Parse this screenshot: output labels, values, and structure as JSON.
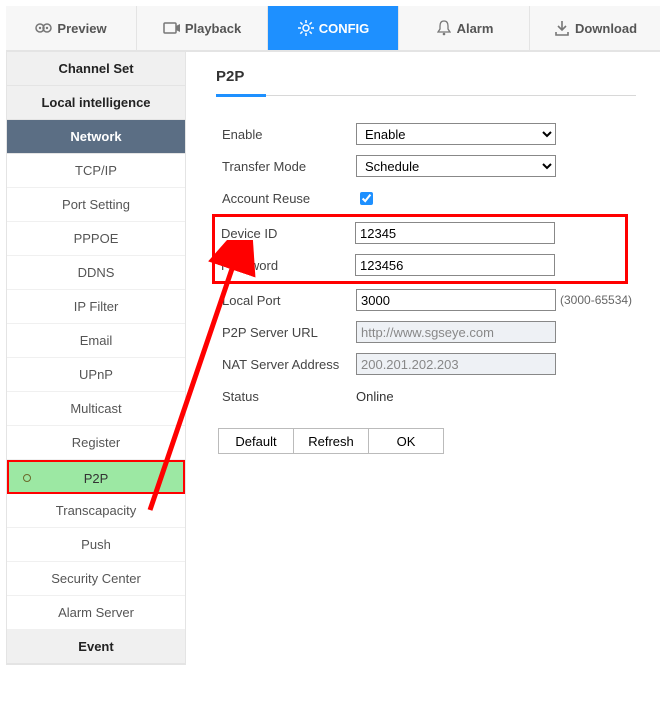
{
  "topnav": {
    "preview": "Preview",
    "playback": "Playback",
    "config": "CONFIG",
    "alarm": "Alarm",
    "download": "Download"
  },
  "sidebar": {
    "channel_set": "Channel Set",
    "local_intel": "Local intelligence",
    "network": "Network",
    "items": {
      "tcpip": "TCP/IP",
      "port": "Port Setting",
      "pppoe": "PPPOE",
      "ddns": "DDNS",
      "ipfilter": "IP Filter",
      "email": "Email",
      "upnp": "UPnP",
      "multicast": "Multicast",
      "register": "Register",
      "p2p": "P2P",
      "transcap": "Transcapacity",
      "push": "Push",
      "seccenter": "Security Center",
      "alarmsrv": "Alarm Server"
    },
    "event": "Event"
  },
  "page": {
    "title": "P2P",
    "labels": {
      "enable": "Enable",
      "transfer": "Transfer Mode",
      "reuse": "Account Reuse",
      "devid": "Device ID",
      "password": "Password",
      "localport": "Local Port",
      "p2purl": "P2P Server URL",
      "nataddr": "NAT Server Address",
      "status": "Status"
    },
    "values": {
      "enable": "Enable",
      "transfer": "Schedule",
      "reuse_checked": true,
      "devid": "12345",
      "password": "123456",
      "localport": "3000",
      "localport_hint": "(3000-65534)",
      "p2purl": "http://www.sgseye.com",
      "nataddr": "200.201.202.203",
      "status": "Online"
    },
    "buttons": {
      "default": "Default",
      "refresh": "Refresh",
      "ok": "OK"
    }
  }
}
